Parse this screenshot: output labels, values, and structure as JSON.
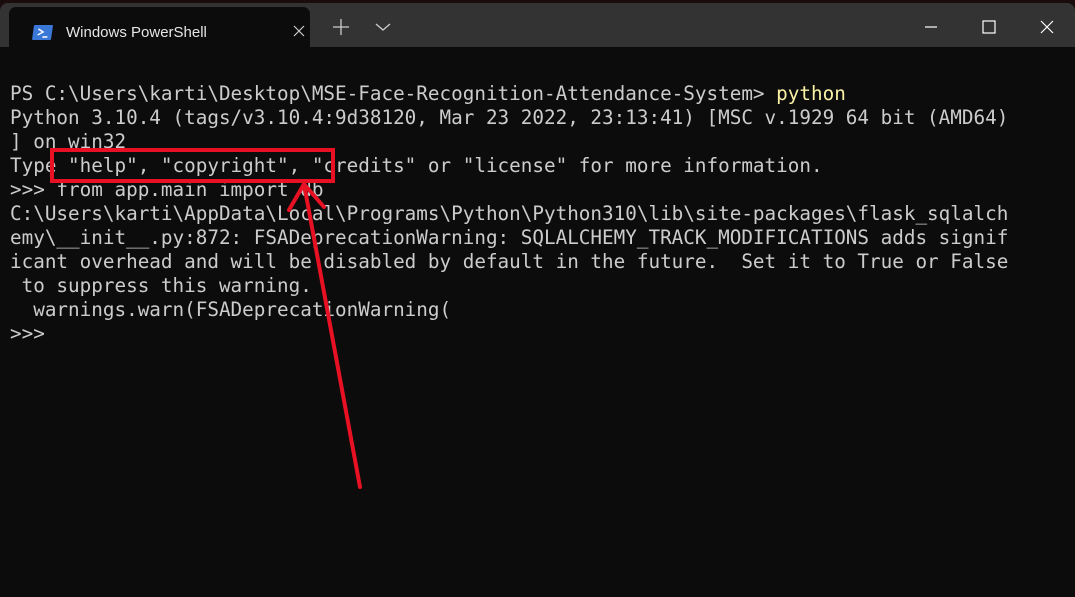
{
  "window": {
    "tab_title": "Windows PowerShell",
    "tab_icon": "powershell-icon",
    "controls": [
      "new-tab-icon",
      "dropdown-chevron-icon",
      "minimize-icon",
      "maximize-icon",
      "close-icon"
    ]
  },
  "terminal": {
    "prompt": "PS C:\\Users\\karti\\Desktop\\MSE-Face-Recognition-Attendance-System> ",
    "command": "python",
    "lines": [
      "Python 3.10.4 (tags/v3.10.4:9d38120, Mar 23 2022, 23:13:41) [MSC v.1929 64 bit (AMD64)",
      "] on win32",
      "Type \"help\", \"copyright\", \"credits\" or \"license\" for more information.",
      ">>> from app.main import db",
      "C:\\Users\\karti\\AppData\\Local\\Programs\\Python\\Python310\\lib\\site-packages\\flask_sqlalch",
      "emy\\__init__.py:872: FSADeprecationWarning: SQLALCHEMY_TRACK_MODIFICATIONS adds signif",
      "icant overhead and will be disabled by default in the future.  Set it to True or False",
      " to suppress this warning.",
      "  warnings.warn(FSADeprecationWarning(",
      ">>>"
    ]
  },
  "colors": {
    "annotation": "#e81123",
    "command": "#f9f1a5",
    "text": "#cccccc",
    "background": "#0c0c0c"
  }
}
